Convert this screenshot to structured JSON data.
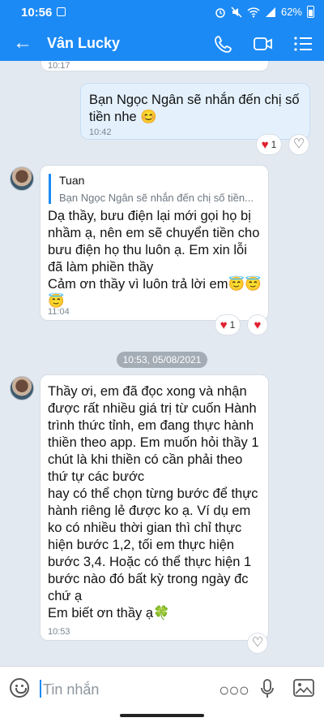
{
  "status": {
    "time": "10:56",
    "battery": "62%"
  },
  "header": {
    "title": "Vân Lucky"
  },
  "messages": [
    {
      "id": "m0",
      "time": "10:17"
    },
    {
      "id": "m1",
      "text": "Bạn Ngọc Ngân sẽ nhắn đến chị số tiền nhe 😊",
      "time": "10:42",
      "reaction_count": "1"
    },
    {
      "id": "m2",
      "reply_name": "Tuan",
      "reply_text": "Bạn Ngọc Ngân sẽ nhắn đến chị số tiền...",
      "text": "Dạ thầy, bưu điện lại mới gọi họ bị nhầm ạ, nên em sẽ chuyển tiền cho bưu điện họ thu luôn ạ. Em xin lỗi đã làm phiền thầy\nCảm ơn thầy vì luôn trả lời em😇😇\n😇",
      "time": "11:04",
      "reaction_count": "1"
    },
    {
      "id": "m3",
      "text": "Thầy ơi, em đã đọc xong và nhận được rất nhiều giá trị từ cuốn Hành trình thức tỉnh, em đang thực hành thiền theo app. Em muốn hỏi thầy 1 chút là khi thiền có cần phải theo thứ tự các bước\nhay có thể chọn từng bước để thực hành riêng lẻ được ko ạ. Ví dụ em ko có nhiều thời gian thì chỉ thực hiện bước 1,2, tối em thực hiện bước 3,4. Hoặc có thể thực hiện 1 bước nào đó bất kỳ trong ngày đc chứ ạ\nEm biết ơn thầy ạ🍀",
      "time": "10:53"
    }
  ],
  "date_separator": "10:53, 05/08/2021",
  "composer": {
    "placeholder": "Tin nhắn"
  },
  "colors": {
    "accent": "#1c8af4",
    "chat_bg": "#e2e9f1",
    "my_bubble": "#e4f1fd"
  },
  "icons": [
    "back-arrow-icon",
    "phone-icon",
    "video-icon",
    "list-menu-icon",
    "emoji-icon",
    "more-icon",
    "mic-icon",
    "image-icon",
    "heart-icon"
  ]
}
